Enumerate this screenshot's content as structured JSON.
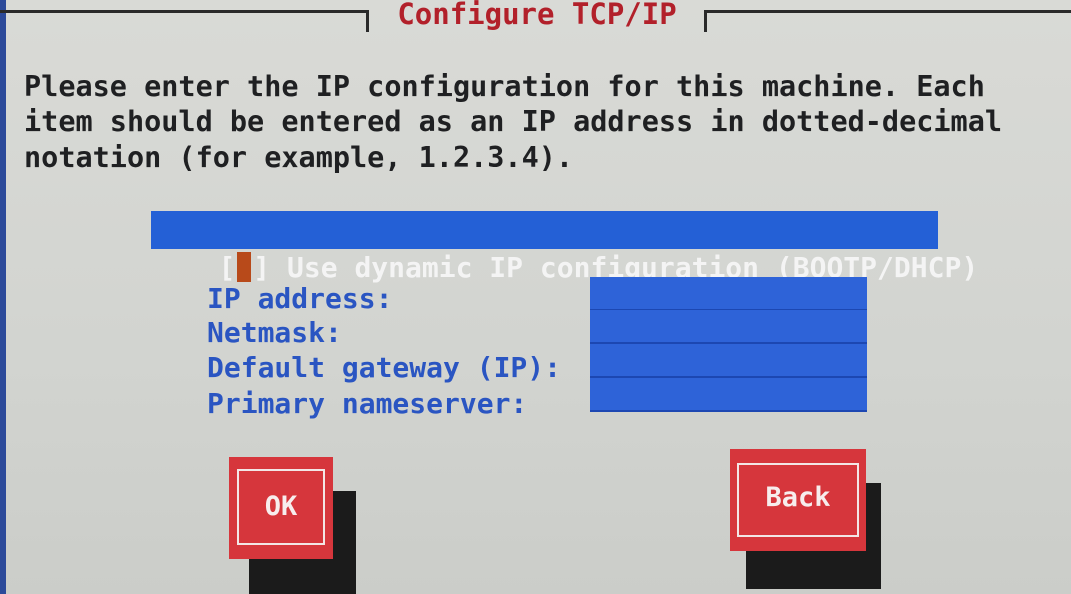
{
  "dialog": {
    "title": "Configure TCP/IP",
    "intro_lines": [
      "Please enter the IP configuration for this machine. Each",
      "item should be entered as an IP address in dotted-decimal",
      "notation (for example, 1.2.3.4)."
    ]
  },
  "dhcp_checkbox": {
    "open_bracket": "[",
    "close_bracket": "]",
    "label": "Use dynamic IP configuration (BOOTP/DHCP)",
    "checked": false
  },
  "fields": [
    {
      "label": "IP address:",
      "value": ""
    },
    {
      "label": "Netmask:",
      "value": ""
    },
    {
      "label": "Default gateway (IP):",
      "value": ""
    },
    {
      "label": "Primary nameserver:",
      "value": ""
    }
  ],
  "buttons": {
    "ok_label": "OK",
    "back_label": "Back"
  },
  "colors": {
    "title": "#b2202a",
    "selection": "#2460d6",
    "label": "#2a55c2",
    "button": "#d6363c",
    "background": "#d4d6d2"
  }
}
